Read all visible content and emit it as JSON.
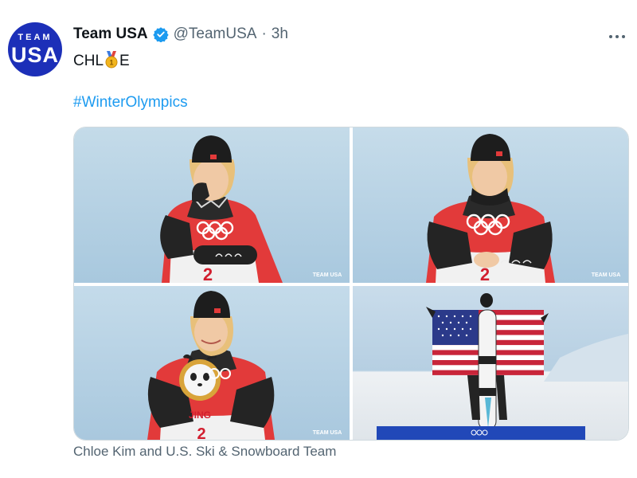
{
  "account": {
    "avatar_top": "TEAM",
    "avatar_bottom": "USA",
    "name": "Team USA",
    "handle": "@TeamUSA",
    "separator": "·",
    "time": "3h"
  },
  "tweet": {
    "text_before": "CHL",
    "emoji": "gold-medal",
    "text_after": "E",
    "hashtag": "#WinterOlympics"
  },
  "media": {
    "watermark": "TEAM USA",
    "bib_number": "2",
    "caption": "Chloe Kim and U.S. Ski & Snowboard Team"
  },
  "colors": {
    "brand_blue": "#1c2fb8",
    "link_blue": "#1d9bf0",
    "verified_blue": "#1d9bf0",
    "muted_text": "#536471"
  }
}
